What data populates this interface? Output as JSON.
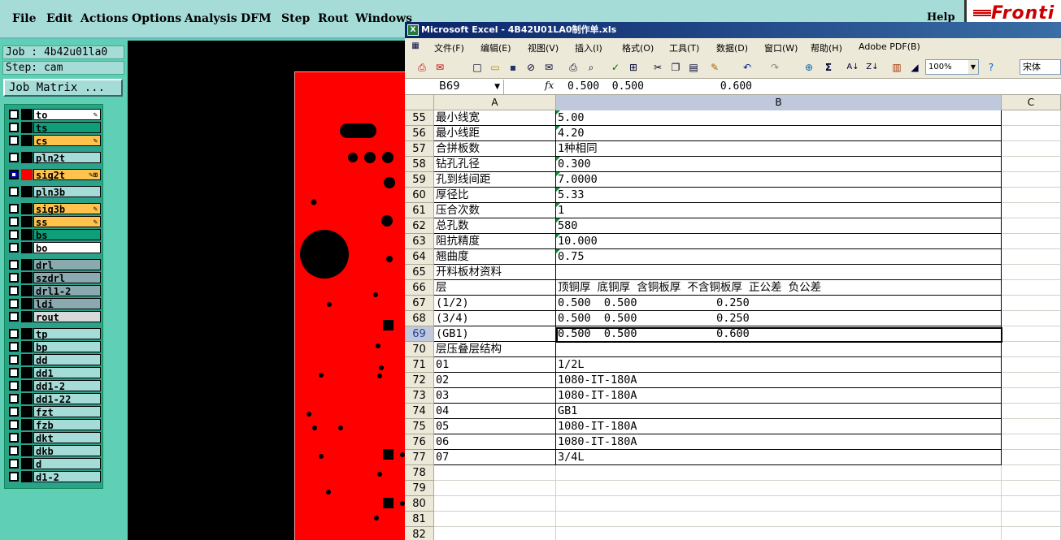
{
  "cam": {
    "menu": [
      "File",
      "Edit",
      "Actions",
      "Options",
      "Analysis",
      "DFM",
      "Step",
      "Rout",
      "Windows"
    ],
    "help": "Help",
    "logo_text": "Fronti",
    "job_label": "Job : 4b42u01la0",
    "step_label": "Step: cam",
    "job_matrix_button": "Job Matrix ...",
    "layers": [
      {
        "name": "to",
        "color": "white",
        "checked": false,
        "icon": "✎"
      },
      {
        "name": "ts",
        "color": "green",
        "checked": false,
        "icon": ""
      },
      {
        "name": "cs",
        "color": "orange",
        "checked": false,
        "icon": "✎"
      },
      {
        "name": "pln2t",
        "color": "teal",
        "checked": false,
        "icon": ""
      },
      {
        "name": "sig2t",
        "color": "orange",
        "checked": true,
        "icon": "✎⊞"
      },
      {
        "name": "pln3b",
        "color": "teal",
        "checked": false,
        "icon": ""
      },
      {
        "name": "sig3b",
        "color": "orange",
        "checked": false,
        "icon": "✎"
      },
      {
        "name": "ss",
        "color": "orange",
        "checked": false,
        "icon": "✎"
      },
      {
        "name": "bs",
        "color": "green",
        "checked": false,
        "icon": ""
      },
      {
        "name": "bo",
        "color": "white",
        "checked": false,
        "icon": ""
      },
      {
        "name": "drl",
        "color": "gray",
        "checked": false,
        "icon": ""
      },
      {
        "name": "szdrl",
        "color": "gray",
        "checked": false,
        "icon": ""
      },
      {
        "name": "drl1-2",
        "color": "gray",
        "checked": false,
        "icon": ""
      },
      {
        "name": "ldi",
        "color": "gray",
        "checked": false,
        "icon": ""
      },
      {
        "name": "rout",
        "color": "lgray",
        "checked": false,
        "icon": ""
      },
      {
        "name": "tp",
        "color": "teal",
        "checked": false,
        "icon": ""
      },
      {
        "name": "bp",
        "color": "teal",
        "checked": false,
        "icon": ""
      },
      {
        "name": "dd",
        "color": "teal",
        "checked": false,
        "icon": ""
      },
      {
        "name": "dd1",
        "color": "teal",
        "checked": false,
        "icon": ""
      },
      {
        "name": "dd1-2",
        "color": "teal",
        "checked": false,
        "icon": ""
      },
      {
        "name": "dd1-22",
        "color": "teal",
        "checked": false,
        "icon": ""
      },
      {
        "name": "fzt",
        "color": "teal",
        "checked": false,
        "icon": ""
      },
      {
        "name": "fzb",
        "color": "teal",
        "checked": false,
        "icon": ""
      },
      {
        "name": "dkt",
        "color": "teal",
        "checked": false,
        "icon": ""
      },
      {
        "name": "dkb",
        "color": "teal",
        "checked": false,
        "icon": ""
      },
      {
        "name": "d",
        "color": "teal",
        "checked": false,
        "icon": ""
      },
      {
        "name": "d1-2",
        "color": "teal",
        "checked": false,
        "icon": ""
      }
    ]
  },
  "excel": {
    "title": "Microsoft Excel - 4B42U01LA0制作单.xls",
    "menu": [
      "文件(F)",
      "编辑(E)",
      "视图(V)",
      "插入(I)",
      "格式(O)",
      "工具(T)",
      "数据(D)",
      "窗口(W)",
      "帮助(H)",
      "Adobe PDF(B)"
    ],
    "zoom": "100%",
    "font": "宋体",
    "name_box": "B69",
    "fx": "fx",
    "formula": "0.500  0.500            0.600",
    "columns": [
      "A",
      "B",
      "C"
    ],
    "selected_row": "69",
    "rows": [
      {
        "n": "55",
        "a": "最小线宽",
        "b": "5.00",
        "mark": true
      },
      {
        "n": "56",
        "a": "最小线距",
        "b": "4.20",
        "mark": true
      },
      {
        "n": "57",
        "a": "合拼板数",
        "b": "1种相同",
        "mark": false
      },
      {
        "n": "58",
        "a": "钻孔孔径",
        "b": "0.300",
        "mark": true
      },
      {
        "n": "59",
        "a": "孔到线间距",
        "b": "7.0000",
        "mark": true
      },
      {
        "n": "60",
        "a": "厚径比",
        "b": "5.33",
        "mark": true
      },
      {
        "n": "61",
        "a": "压合次数",
        "b": "1",
        "mark": true
      },
      {
        "n": "62",
        "a": "总孔数",
        "b": "580",
        "mark": true
      },
      {
        "n": "63",
        "a": "阻抗精度",
        "b": "10.000",
        "mark": true
      },
      {
        "n": "64",
        "a": "翘曲度",
        "b": "0.75",
        "mark": true
      },
      {
        "n": "65",
        "a": "开料板材资料",
        "b": "",
        "mark": false
      },
      {
        "n": "66",
        "a": "层",
        "b": "顶铜厚 底铜厚 含铜板厚 不含铜板厚 正公差 负公差",
        "mark": false
      },
      {
        "n": "67",
        "a": "(1/2)",
        "b": "0.500  0.500            0.250",
        "mark": false
      },
      {
        "n": "68",
        "a": "(3/4)",
        "b": "0.500  0.500            0.250",
        "mark": false
      },
      {
        "n": "69",
        "a": "(GB1)",
        "b": "0.500  0.500            0.600",
        "mark": false
      },
      {
        "n": "70",
        "a": "层压叠层结构",
        "b": "",
        "mark": false
      },
      {
        "n": "71",
        "a": "01",
        "b": "1/2L",
        "mark": false
      },
      {
        "n": "72",
        "a": "02",
        "b": "1080-IT-180A",
        "mark": false
      },
      {
        "n": "73",
        "a": "03",
        "b": "1080-IT-180A",
        "mark": false
      },
      {
        "n": "74",
        "a": "04",
        "b": "GB1",
        "mark": false
      },
      {
        "n": "75",
        "a": "05",
        "b": "1080-IT-180A",
        "mark": false
      },
      {
        "n": "76",
        "a": "06",
        "b": "1080-IT-180A",
        "mark": false
      },
      {
        "n": "77",
        "a": "07",
        "b": "3/4L",
        "mark": false
      },
      {
        "n": "78",
        "a": "",
        "b": "",
        "mark": false
      },
      {
        "n": "79",
        "a": "",
        "b": "",
        "mark": false
      },
      {
        "n": "80",
        "a": "",
        "b": "",
        "mark": false
      },
      {
        "n": "81",
        "a": "",
        "b": "",
        "mark": false
      },
      {
        "n": "82",
        "a": "",
        "b": "",
        "mark": false
      }
    ]
  }
}
